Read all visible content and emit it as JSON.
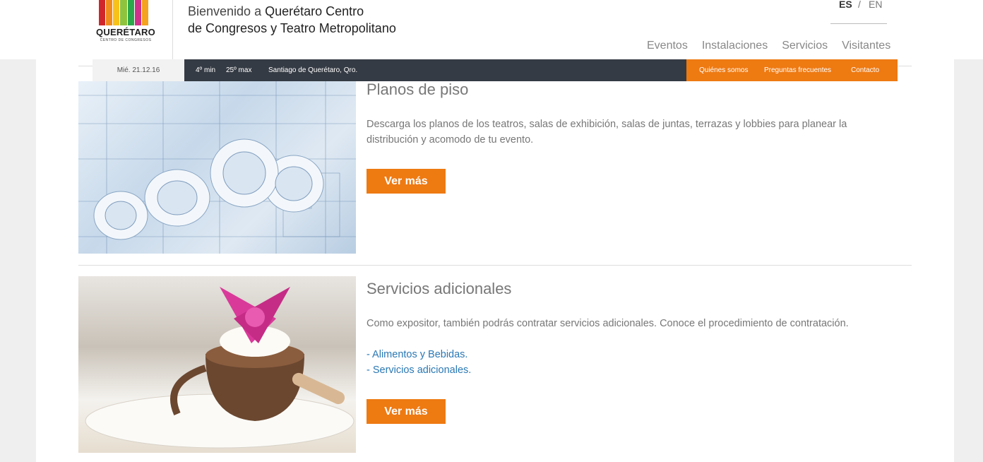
{
  "header": {
    "logo_name": "QUERÉTARO",
    "logo_sub": "CENTRO DE CONGRESOS",
    "logo_colors": [
      "#d0262b",
      "#f08a1d",
      "#f7c21a",
      "#8fc33e",
      "#2aa84a",
      "#d02f8a",
      "#f4a21f"
    ],
    "welcome_prefix": "Bienvenido a ",
    "welcome_bold": "Querétaro Centro",
    "welcome_line2": "de Congresos y Teatro Metropolitano",
    "lang_es": "ES",
    "lang_sep": "/",
    "lang_en": "EN",
    "nav": [
      "Eventos",
      "Instalaciones",
      "Servicios",
      "Visitantes"
    ]
  },
  "infobar": {
    "date": "Mié. 21.12.16",
    "temp_min": "4º min",
    "temp_max": "25º max",
    "city": "Santiago de Querétaro, Qro.",
    "links": [
      "Quiénes somos",
      "Preguntas frecuentes",
      "Contacto"
    ]
  },
  "cards": [
    {
      "title": "Planos de piso",
      "text": "Descarga los planos de los teatros, salas de exhibición, salas de juntas, terrazas y lobbies para planear la distribución y acomodo de tu evento.",
      "button": "Ver más"
    },
    {
      "title": "Servicios adicionales",
      "text": "Como expositor, también podrás contratar servicios adicionales. Conoce el procedimiento de contratación.",
      "links": [
        "- Alimentos y Bebidas.",
        "- Servicios adicionales."
      ],
      "button": "Ver más"
    }
  ],
  "colors": {
    "accent": "#ee7a12",
    "dark_bar": "#353b44",
    "link": "#2a78b4"
  }
}
